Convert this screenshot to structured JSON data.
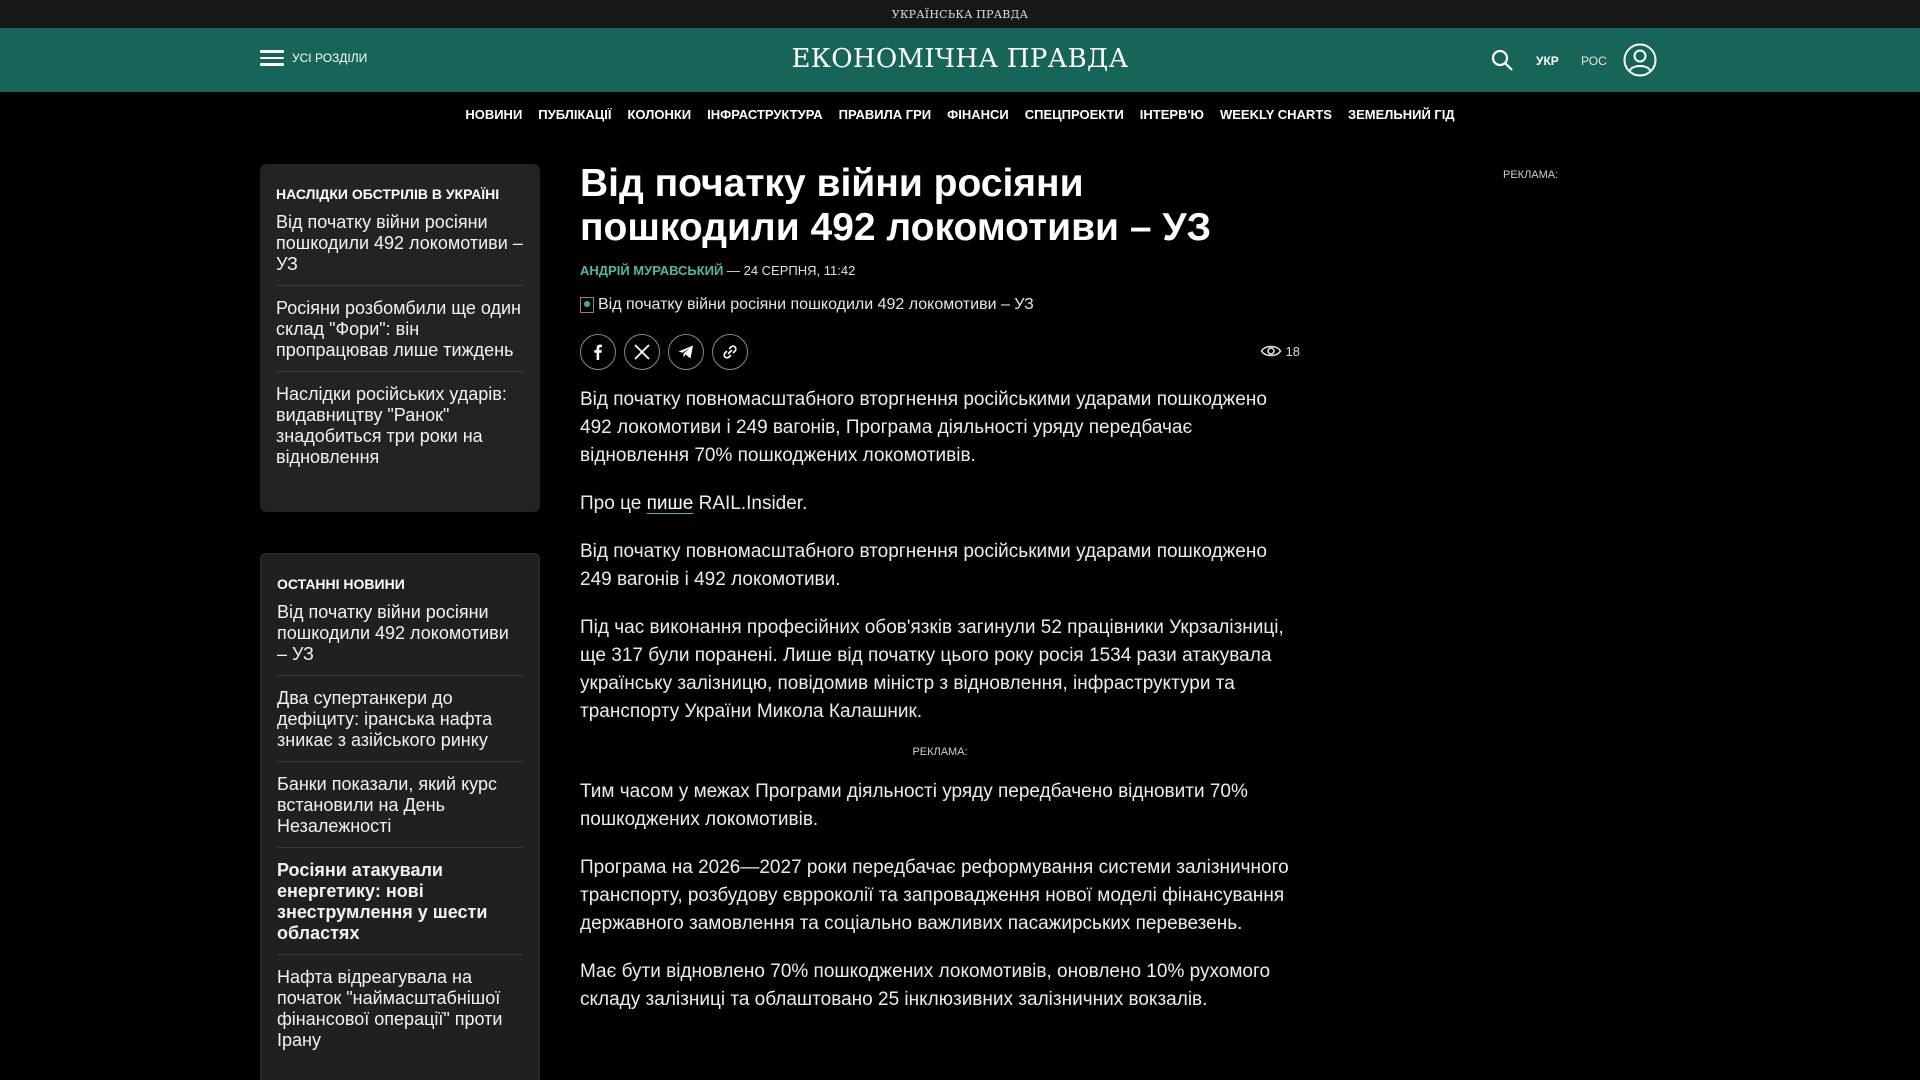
{
  "topbar": {
    "title": "УКРАЇНСЬКА ПРАВДА"
  },
  "header": {
    "menu_label": "УСІ РОЗДІЛИ",
    "logo": "ЕКОНОМІЧНА ПРАВДА",
    "lang_ukr": "УКР",
    "lang_ros": "РОС",
    "icons": [
      "menu-icon",
      "search-icon",
      "user-icon"
    ]
  },
  "nav": {
    "items": [
      "НОВИНИ",
      "ПУБЛІКАЦІЇ",
      "КОЛОНКИ",
      "ІНФРАСТРУКТУРА",
      "ПРАВИЛА ГРИ",
      "ФІНАНСИ",
      "СПЕЦПРОЕКТИ",
      "ІНТЕРВ'Ю",
      "WEEKLY CHARTS",
      "ЗЕМЕЛЬНИЙ ГІД"
    ]
  },
  "sidebar": {
    "topic": {
      "heading": "НАСЛІДКИ ОБСТРІЛІВ В УКРАЇНІ",
      "items": [
        "Від початку війни росіяни пошкодили 492 локомотиви – УЗ",
        "Росіяни розбомбили ще один склад \"Фори\": він пропрацював лише тиждень",
        "Наслідки російських ударів: видавництву \"Ранок\" знадобиться три роки на відновлення"
      ]
    },
    "latest": {
      "heading": "ОСТАННІ НОВИНИ",
      "items": [
        "Від початку війни росіяни пошкодили 492 локомотиви – УЗ",
        "Два супертанкери до дефіциту: іранська нафта зникає з азійського ринку",
        "Банки показали, який курс встановили на День Незалежності",
        "Росіяни атакували енергетику: нові знеструмлення у шести областях",
        "Нафта відреагувала на початок \"наймасштабнішої фінансової операції\" проти Ірану"
      ]
    }
  },
  "article": {
    "title": "Від початку війни росіяни пошкодили 492 локомотиви – УЗ",
    "author": "АНДРІЙ МУРАВСЬКИЙ",
    "date": " — 24 СЕРПНЯ, 11:42",
    "image_alt": "Від початку війни росіяни пошкодили 492 локомотиви – УЗ",
    "views": "18",
    "share_icons": [
      "facebook-icon",
      "x-icon",
      "telegram-icon",
      "link-icon"
    ],
    "lead": "Від початку повномасштабного вторгнення російськими ударами пошкоджено 492 локомотиви і 249 вагонів, Програма діяльності уряду передбачає відновлення 70% пошкоджених локомотивів.",
    "source_prefix": "Про це ",
    "source_link": "пише",
    "source_suffix": " RAIL.Insider.",
    "p1": "Від початку повномасштабного вторгнення російськими ударами пошкоджено 249 вагонів і 492 локомотиви.",
    "p2": "Під час виконання професійних обов'язків загинули 52 працівники Укрзалізниці, ще 317 були поранені. Лише від початку цього року росія 1534 рази атакувала українську залізницю, повідомив міністр з відновлення, інфраструктури та транспорту України Микола Калашник.",
    "ad_label": "РЕКЛАМА:",
    "p3": "Тим часом у межах Програми діяльності уряду передбачено відновити 70% пошкоджених локомотивів.",
    "p4": "Програма на 2026—2027 роки передбачає реформування системи залізничного транспорту, розбудову єврроколії та запровадження нової моделі фінансування державного замовлення та соціально важливих пасажирських перевезень.",
    "p5": "Має бути відновлено 70% пошкоджених локомотивів, оновлено 10% рухомого складу залізниці та облаштовано 25 інклюзивних залізничних вокзалів."
  },
  "ad_right": {
    "label": "РЕКЛАМА:"
  },
  "colors": {
    "header_bg": "#176459",
    "accent": "#56b5a3",
    "page_bg": "#000000",
    "sidebar_bg": "#222325"
  }
}
